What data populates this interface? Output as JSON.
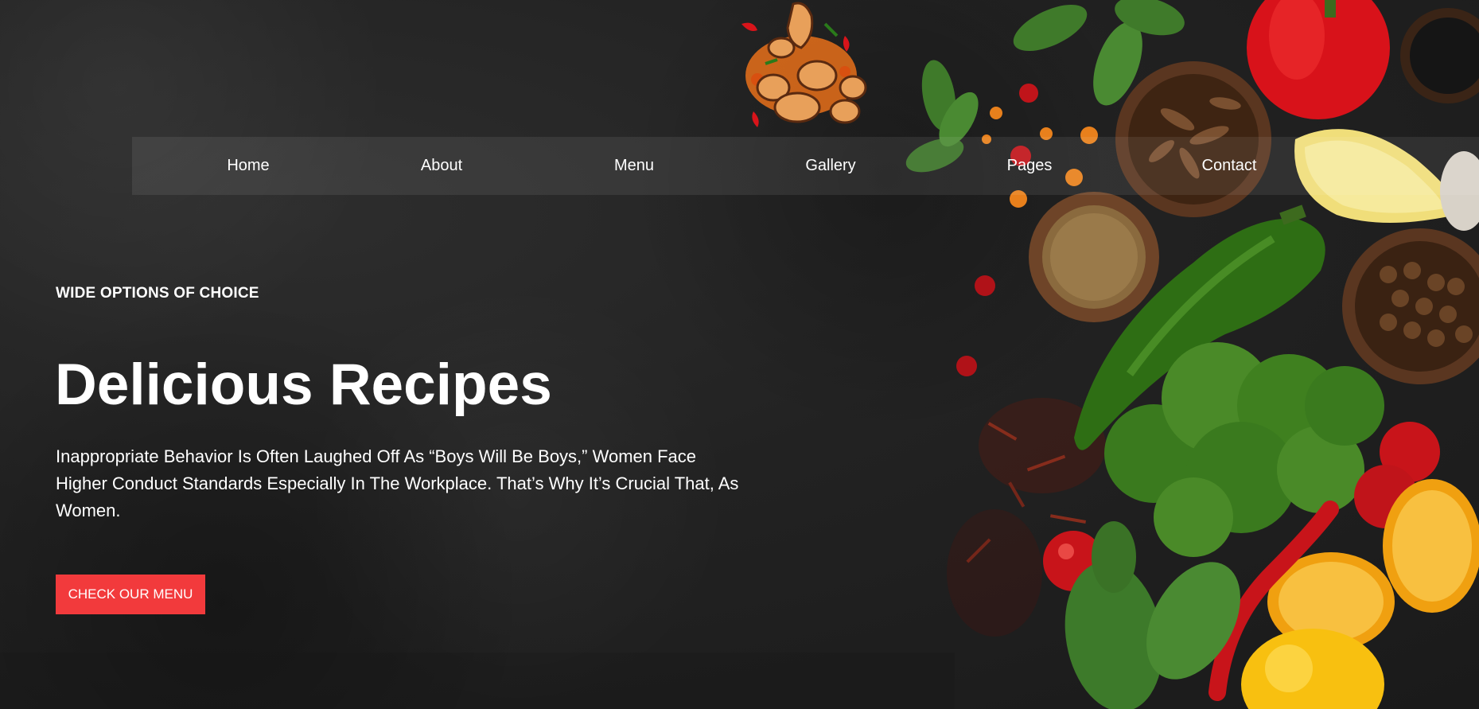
{
  "logo": {
    "icon": "food-logo-icon"
  },
  "nav": {
    "items": [
      {
        "label": "Home"
      },
      {
        "label": "About"
      },
      {
        "label": "Menu"
      },
      {
        "label": "Gallery"
      },
      {
        "label": "Pages"
      },
      {
        "label": "Contact"
      }
    ]
  },
  "hero": {
    "eyebrow": "WIDE OPTIONS OF CHOICE",
    "title": "Delicious Recipes",
    "description": "Inappropriate Behavior Is Often Laughed Off As “Boys Will Be Boys,” Women Face Higher Conduct Standards Especially In The Workplace. That’s Why It’s Crucial That, As Women.",
    "cta_label": "CHECK OUR MENU"
  },
  "colors": {
    "background": "#232323",
    "accent": "#f23a3c",
    "text": "#ffffff"
  }
}
